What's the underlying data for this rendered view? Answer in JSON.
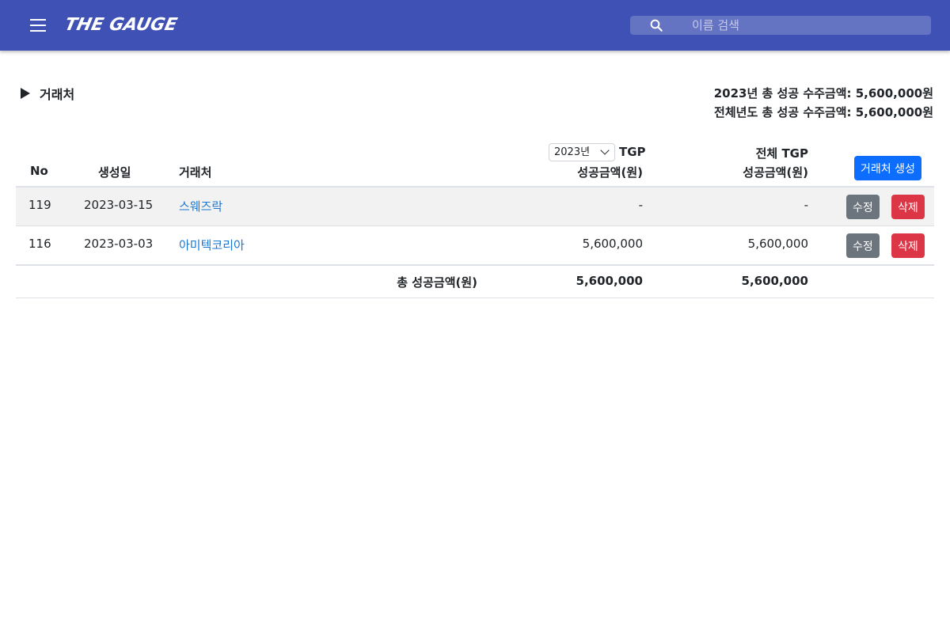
{
  "header": {
    "logo": "THE GAUGE",
    "search_placeholder": "이름 검색"
  },
  "section": {
    "toggle_label": "거래처"
  },
  "totals": {
    "year_total": "2023년 총 성공 수주금액: 5,600,000원",
    "all_total": "전체년도 총 성공 수주금액: 5,600,000원"
  },
  "table": {
    "headers": {
      "no": "No",
      "created": "생성일",
      "client": "거래처",
      "year_select": "2023년",
      "tgp_suffix": "TGP",
      "tgp_amount": "성공금액(원)",
      "total_tgp_line1": "전체 TGP",
      "total_tgp_line2": "성공금액(원)"
    },
    "create_button": "거래처 생성",
    "rows": [
      {
        "no": "119",
        "created": "2023-03-15",
        "client": "스웨즈락",
        "year_amount": "-",
        "total_amount": "-",
        "edit": "수정",
        "delete": "삭제"
      },
      {
        "no": "116",
        "created": "2023-03-03",
        "client": "아미텍코리아",
        "year_amount": "5,600,000",
        "total_amount": "5,600,000",
        "edit": "수정",
        "delete": "삭제"
      }
    ],
    "footer": {
      "label": "총 성공금액(원)",
      "year_total": "5,600,000",
      "all_total": "5,600,000"
    }
  },
  "colors": {
    "appbar": "#3f51b5",
    "link": "#1976d2",
    "edit_button": "#6c757d",
    "delete_button": "#dc3545",
    "create_button": "#0d6efd"
  }
}
